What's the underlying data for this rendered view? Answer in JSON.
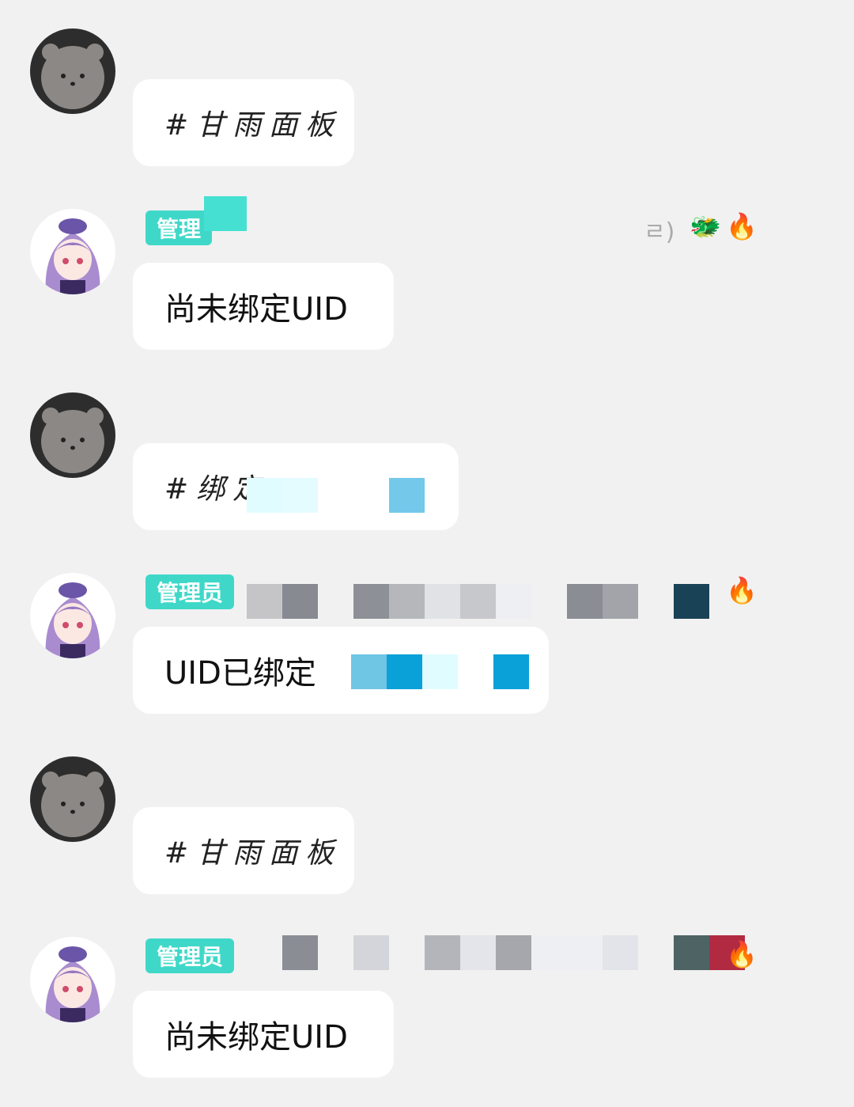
{
  "messages": [
    {
      "sender": "user",
      "text": "#甘雨面板"
    },
    {
      "sender": "bot",
      "badge": "管理",
      "text": "尚未绑定UID",
      "name_fragment": "ㄹ)"
    },
    {
      "sender": "user",
      "text": "#绑定"
    },
    {
      "sender": "bot",
      "badge": "管理员",
      "text": "UID已绑定"
    },
    {
      "sender": "user",
      "text": "#甘雨面板"
    },
    {
      "sender": "bot",
      "badge": "管理员",
      "text": "尚未绑定UID"
    }
  ],
  "icons": {
    "dragon": "dragon-icon",
    "fire": "fire-icon"
  },
  "colors": {
    "badge": "#3fd8c8",
    "background": "#f1f1f1",
    "bubble": "#ffffff"
  }
}
